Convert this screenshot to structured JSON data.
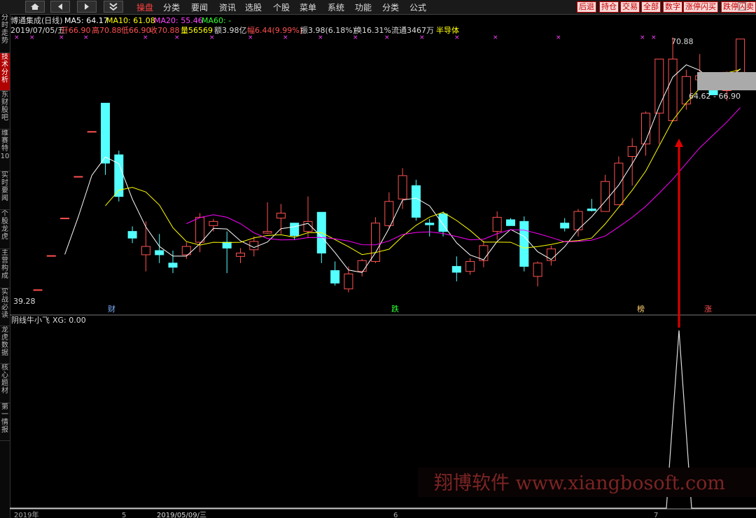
{
  "toolbar": {
    "menu": [
      "操盘",
      "分类",
      "要闻",
      "资讯",
      "选股",
      "个股",
      "菜单",
      "系统",
      "功能",
      "分类",
      "公式"
    ],
    "active_index": 0,
    "right_buttons": [
      "后退",
      "持仓",
      "交易",
      "全部",
      "数字",
      "涨停闪买",
      "跌停闪卖"
    ]
  },
  "left_nav": [
    "分时走势",
    "技术分析",
    "东财股吧",
    "维赛特10",
    "实时要闻",
    "个股龙虎",
    "主营构成",
    "实战必读",
    "龙虎数据",
    "核心题材",
    "第一情报"
  ],
  "left_nav_active": 1,
  "header": {
    "name_line": "博通集成(日线)",
    "ma5": "MA5: 64.17",
    "ma10": "MA10: 61.08",
    "ma20": "MA20: 55.46",
    "ma60": "MA60: -",
    "date": "2019/07/05/五",
    "open": "开66.90",
    "high": "高70.88",
    "low": "低66.90",
    "close": "收70.88",
    "vol": "量56569",
    "amount": "额3.98亿",
    "range": "幅6.44(9.99%)",
    "amp": "振3.98(6.18%)",
    "turnover": "换16.31%",
    "float": "流通3467万",
    "sector": "半导体"
  },
  "price_labels": {
    "high": "70.88",
    "low": "39.28",
    "range": "64.62 - 66.90"
  },
  "event_markers": [
    "财",
    "跌",
    "榜",
    "涨"
  ],
  "indicator": {
    "label": "阴线牛小飞",
    "xg": "XG: 0.00"
  },
  "bottom_axis": [
    "2019年",
    "5",
    "2019/05/09/三",
    "6",
    "7"
  ],
  "watermark": "翔博软件 www.xiangbosoft.com",
  "colors": {
    "up": "#ff5050",
    "down": "#54ffff",
    "ma5": "#ffffff",
    "ma10": "#ffff00",
    "ma20": "#ff00ff",
    "arrow": "#e00000"
  },
  "chart_data": {
    "type": "candlestick",
    "ylim": [
      39.28,
      70.88
    ],
    "candles": [
      {
        "o": 40.8,
        "h": 40.8,
        "l": 40.8,
        "c": 40.8
      },
      {
        "o": 44.9,
        "h": 44.9,
        "l": 44.9,
        "c": 44.9
      },
      {
        "o": 49.4,
        "h": 49.4,
        "l": 49.4,
        "c": 49.4
      },
      {
        "o": 54.4,
        "h": 54.4,
        "l": 54.4,
        "c": 54.4
      },
      {
        "o": 59.8,
        "h": 59.8,
        "l": 59.8,
        "c": 59.8
      },
      {
        "o": 63.2,
        "h": 63.2,
        "l": 54.6,
        "c": 56.0
      },
      {
        "o": 57.0,
        "h": 57.5,
        "l": 51.4,
        "c": 52.0
      },
      {
        "o": 47.8,
        "h": 48.4,
        "l": 46.4,
        "c": 47.0
      },
      {
        "o": 45.0,
        "h": 49.0,
        "l": 43.0,
        "c": 46.0
      },
      {
        "o": 45.5,
        "h": 47.5,
        "l": 44.0,
        "c": 45.0
      },
      {
        "o": 44.0,
        "h": 45.5,
        "l": 42.8,
        "c": 43.5
      },
      {
        "o": 45.0,
        "h": 46.5,
        "l": 44.5,
        "c": 46.0
      },
      {
        "o": 46.5,
        "h": 50.0,
        "l": 45.3,
        "c": 49.5
      },
      {
        "o": 48.5,
        "h": 49.3,
        "l": 47.8,
        "c": 49.0
      },
      {
        "o": 46.5,
        "h": 47.8,
        "l": 42.8,
        "c": 45.8
      },
      {
        "o": 44.8,
        "h": 45.8,
        "l": 44.0,
        "c": 45.2
      },
      {
        "o": 45.6,
        "h": 47.2,
        "l": 44.8,
        "c": 46.6
      },
      {
        "o": 47.6,
        "h": 51.3,
        "l": 47.5,
        "c": 47.8
      },
      {
        "o": 49.4,
        "h": 51.1,
        "l": 47.5,
        "c": 50.0
      },
      {
        "o": 48.8,
        "h": 47.8,
        "l": 46.8,
        "c": 47.3
      },
      {
        "o": 47.8,
        "h": 52.0,
        "l": 47.0,
        "c": 49.0
      },
      {
        "o": 50.1,
        "h": 50.1,
        "l": 44.0,
        "c": 45.2
      },
      {
        "o": 43.1,
        "h": 44.2,
        "l": 41.3,
        "c": 41.6
      },
      {
        "o": 40.9,
        "h": 43.6,
        "l": 40.5,
        "c": 42.7
      },
      {
        "o": 43.0,
        "h": 44.5,
        "l": 42.4,
        "c": 44.3
      },
      {
        "o": 44.2,
        "h": 49.5,
        "l": 44.0,
        "c": 48.8
      },
      {
        "o": 48.5,
        "h": 52.5,
        "l": 48.2,
        "c": 51.4
      },
      {
        "o": 51.7,
        "h": 55.4,
        "l": 50.5,
        "c": 54.5
      },
      {
        "o": 53.3,
        "h": 54.0,
        "l": 49.1,
        "c": 49.5
      },
      {
        "o": 48.8,
        "h": 49.3,
        "l": 47.2,
        "c": 48.6
      },
      {
        "o": 49.9,
        "h": 50.2,
        "l": 47.2,
        "c": 47.8
      },
      {
        "o": 43.6,
        "h": 44.8,
        "l": 41.8,
        "c": 42.9
      },
      {
        "o": 43.0,
        "h": 44.6,
        "l": 42.6,
        "c": 44.2
      },
      {
        "o": 44.3,
        "h": 46.7,
        "l": 43.5,
        "c": 46.1
      },
      {
        "o": 47.8,
        "h": 50.2,
        "l": 46.8,
        "c": 49.5
      },
      {
        "o": 49.2,
        "h": 49.4,
        "l": 48.5,
        "c": 48.5
      },
      {
        "o": 49.0,
        "h": 49.6,
        "l": 43.0,
        "c": 43.6
      },
      {
        "o": 42.4,
        "h": 44.2,
        "l": 41.2,
        "c": 44.0
      },
      {
        "o": 44.3,
        "h": 46.1,
        "l": 43.7,
        "c": 45.7
      },
      {
        "o": 48.8,
        "h": 49.4,
        "l": 47.8,
        "c": 48.2
      },
      {
        "o": 48.0,
        "h": 50.5,
        "l": 47.2,
        "c": 50.2
      },
      {
        "o": 50.5,
        "h": 51.7,
        "l": 50.2,
        "c": 50.3
      },
      {
        "o": 50.2,
        "h": 54.6,
        "l": 50.2,
        "c": 53.8
      },
      {
        "o": 51.0,
        "h": 56.8,
        "l": 51.0,
        "c": 56.0
      },
      {
        "o": 56.8,
        "h": 59.0,
        "l": 53.3,
        "c": 58.0
      },
      {
        "o": 58.3,
        "h": 62.2,
        "l": 56.9,
        "c": 62.0
      },
      {
        "o": 62.0,
        "h": 66.4,
        "l": 58.3,
        "c": 68.5
      },
      {
        "o": 61.1,
        "h": 71.1,
        "l": 61.0,
        "c": 68.5
      },
      {
        "o": 63.1,
        "h": 67.2,
        "l": 62.4,
        "c": 66.4
      },
      {
        "o": 66.0,
        "h": 69.1,
        "l": 65.0,
        "c": 66.5
      },
      {
        "o": 64.7,
        "h": 65.2,
        "l": 64.6,
        "c": 64.2
      },
      {
        "o": 64.7,
        "h": 67.0,
        "l": 63.5,
        "c": 66.9
      },
      {
        "o": 66.9,
        "h": 70.9,
        "l": 66.9,
        "c": 70.9
      }
    ]
  }
}
